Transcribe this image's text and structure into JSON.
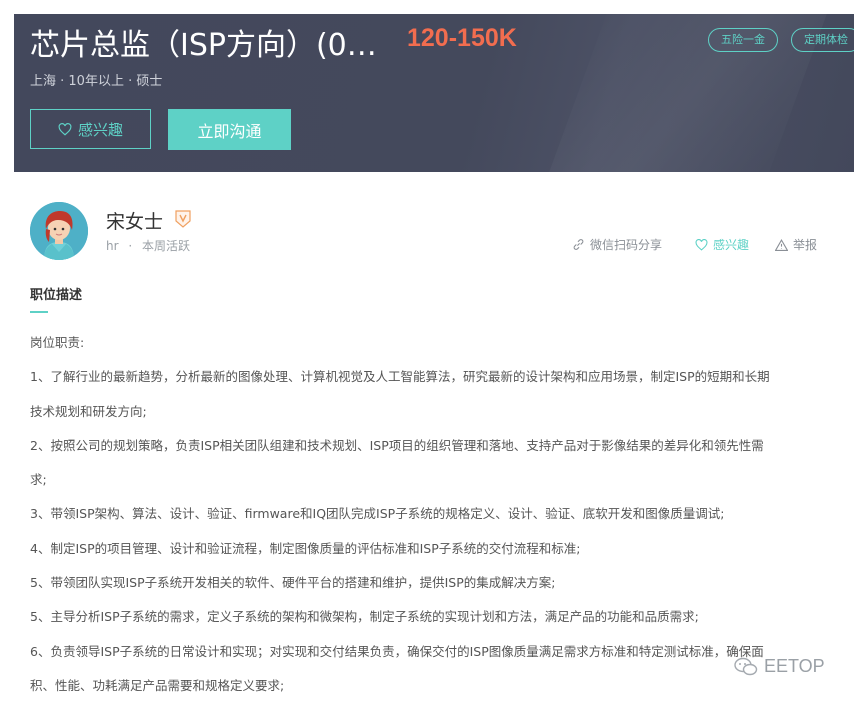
{
  "job": {
    "title": "芯片总监（ISP方向）(0…",
    "salary": "120-150K",
    "meta": "上海 · 10年以上 · 硕士",
    "tags": [
      "五险一金",
      "定期体检"
    ],
    "interest_label": "感兴趣",
    "chat_label": "立即沟通"
  },
  "recruiter": {
    "name": "宋女士",
    "role": "hr",
    "separator": "·",
    "status": "本周活跃"
  },
  "actions": {
    "share": "微信扫码分享",
    "interest": "感兴趣",
    "report": "举报"
  },
  "description": {
    "title": "职位描述",
    "lines": [
      "岗位职责:",
      "1、了解行业的最新趋势，分析最新的图像处理、计算机视觉及人工智能算法，研究最新的设计架构和应用场景，制定ISP的短期和长期",
      "技术规划和研发方向;",
      "2、按照公司的规划策略，负责ISP相关团队组建和技术规划、ISP项目的组织管理和落地、支持产品对于影像结果的差异化和领先性需",
      "求;",
      "3、带领ISP架构、算法、设计、验证、firmware和IQ团队完成ISP子系统的规格定义、设计、验证、底软开发和图像质量调试;",
      "4、制定ISP的项目管理、设计和验证流程，制定图像质量的评估标准和ISP子系统的交付流程和标准;",
      "5、带领团队实现ISP子系统开发相关的软件、硬件平台的搭建和维护，提供ISP的集成解决方案;",
      "5、主导分析ISP子系统的需求，定义子系统的架构和微架构，制定子系统的实现计划和方法，满足产品的功能和品质需求;",
      "6、负责领导ISP子系统的日常设计和实现；对实现和交付结果负责，确保交付的ISP图像质量满足需求方标准和特定测试标准，确保面",
      "积、性能、功耗满足产品需要和规格定义要求;"
    ]
  },
  "watermark": "EETOP",
  "colors": {
    "accent": "#5ed1c6",
    "salary": "#f26d4f",
    "header_bg": "#44495c"
  }
}
